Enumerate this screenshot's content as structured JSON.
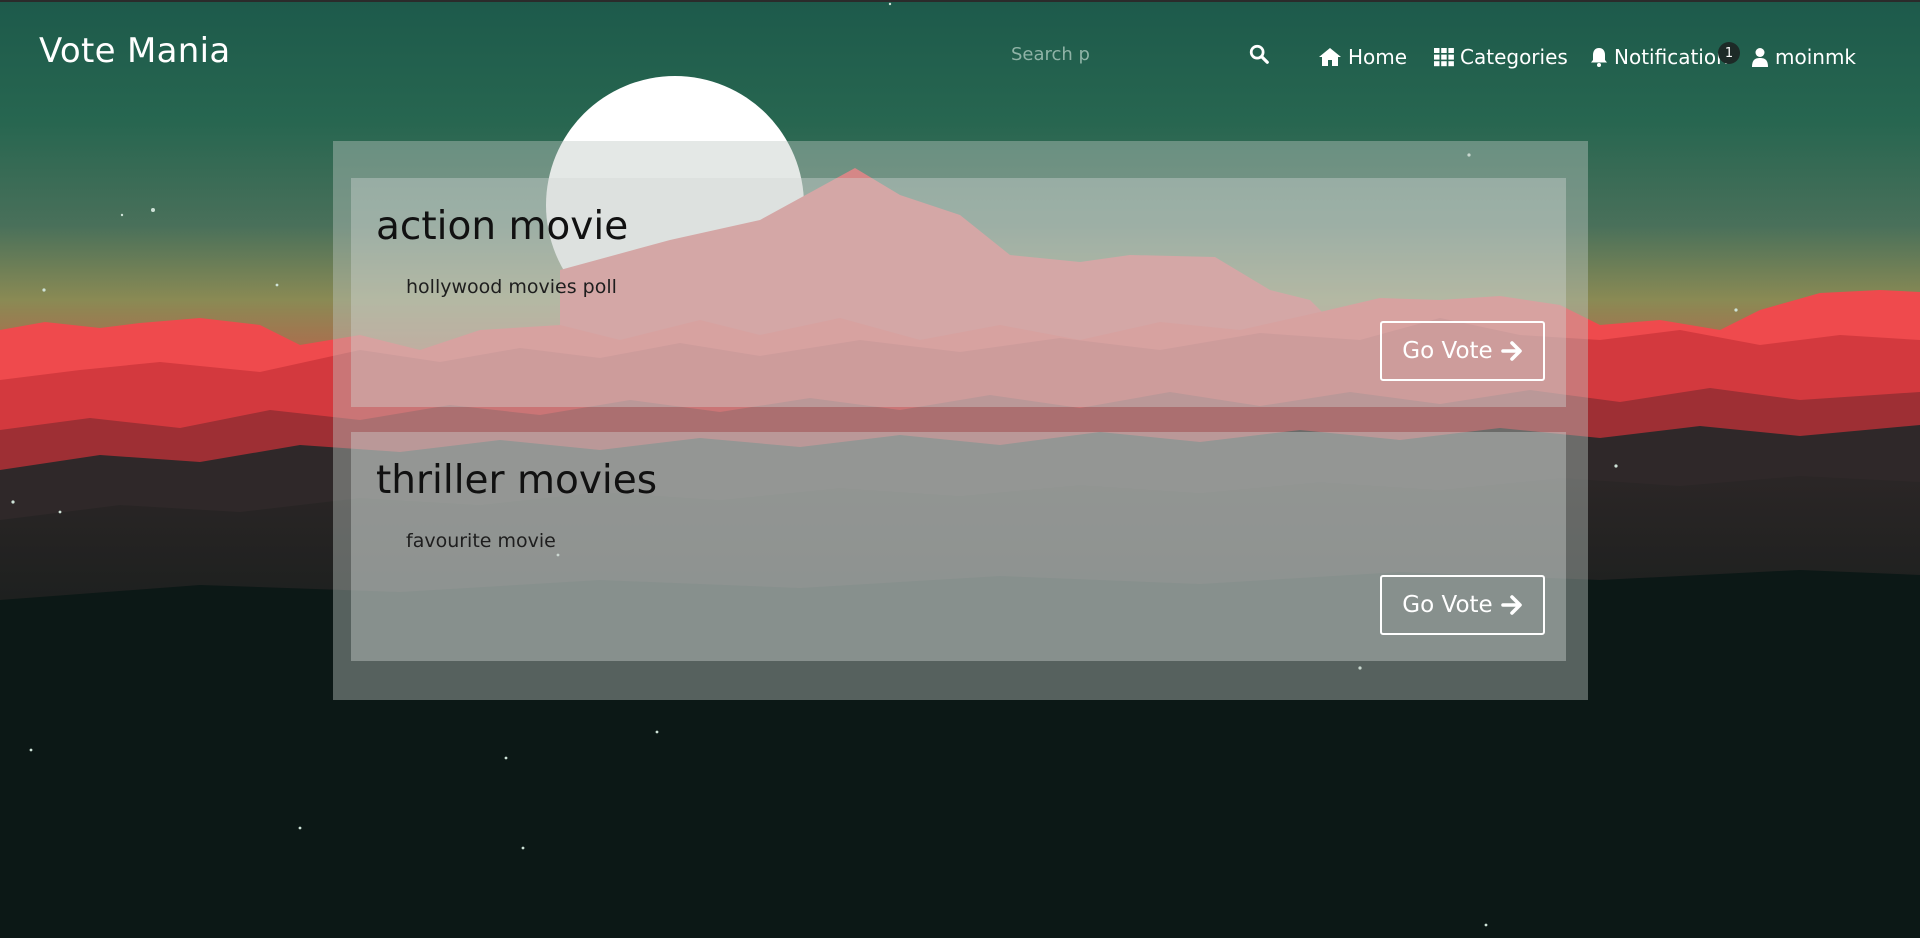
{
  "navbar": {
    "brand": "Vote Mania",
    "search_placeholder": "Search p",
    "search_icon": "search-icon",
    "items": [
      {
        "label": "Home",
        "icon": "home-icon"
      },
      {
        "label": "Categories",
        "icon": "grid-icon"
      },
      {
        "label": "Notification",
        "icon": "bell-icon",
        "badge": "1"
      },
      {
        "label": "moinmk",
        "icon": "user-icon"
      }
    ]
  },
  "polls": [
    {
      "title": "action movie",
      "description": "hollywood movies poll",
      "button_label": "Go Vote",
      "button_icon": "arrow-right-icon"
    },
    {
      "title": "thriller movies",
      "description": "favourite movie",
      "button_label": "Go Vote",
      "button_icon": "arrow-right-icon"
    }
  ],
  "colors": {
    "sky_top": "#1e5c4c",
    "sky_horizon": "#9aa25a",
    "mountain_red": "#ee4b4e",
    "mountain_dark": "#0b1715",
    "panel_bg": "#bec8c4"
  }
}
